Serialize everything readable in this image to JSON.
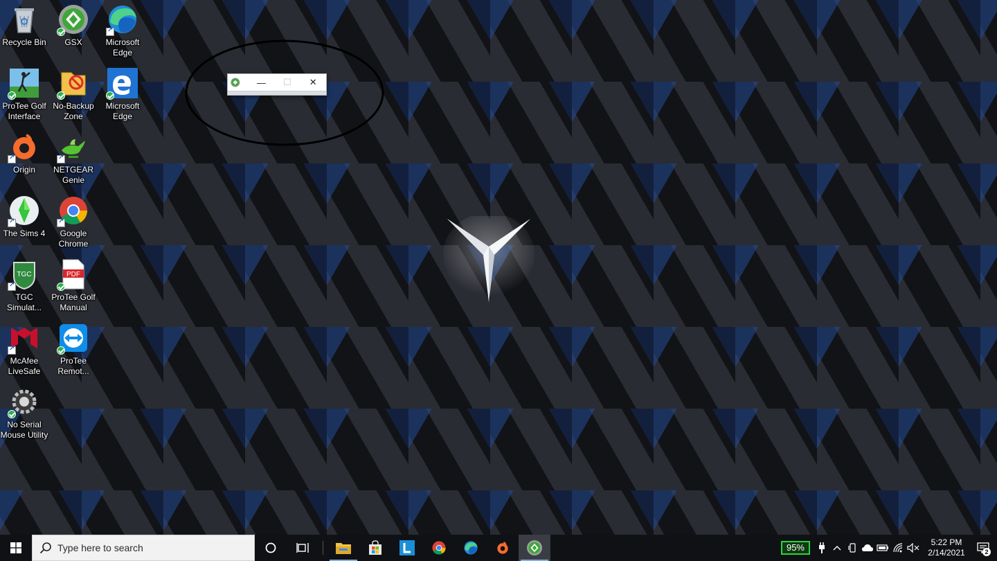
{
  "desktop": {
    "icons": [
      {
        "label": "Recycle Bin",
        "icon": "recycle-bin-icon"
      },
      {
        "label": "GSX",
        "icon": "gsx-icon"
      },
      {
        "label": "Microsoft Edge",
        "icon": "edge-new-icon"
      },
      {
        "label": "ProTee Golf Interface",
        "icon": "golfer-icon"
      },
      {
        "label": "No-Backup Zone",
        "icon": "no-backup-folder-icon"
      },
      {
        "label": "Microsoft Edge",
        "icon": "edge-legacy-icon"
      },
      {
        "label": "Origin",
        "icon": "origin-icon"
      },
      {
        "label": "NETGEAR Genie",
        "icon": "genie-lamp-icon"
      },
      {
        "label": "The Sims 4",
        "icon": "sims-plumbob-icon"
      },
      {
        "label": "Google Chrome",
        "icon": "chrome-icon"
      },
      {
        "label": "TGC Simulat...",
        "icon": "tgc-icon"
      },
      {
        "label": "ProTee Golf Manual",
        "icon": "pdf-icon"
      },
      {
        "label": "McAfee LiveSafe",
        "icon": "mcafee-icon"
      },
      {
        "label": "ProTee Remot...",
        "icon": "teamviewer-icon"
      },
      {
        "label": "No Serial Mouse Utility",
        "icon": "gear-icon"
      }
    ]
  },
  "mini_window": {
    "minimize_glyph": "—",
    "maximize_glyph": "☐",
    "close_glyph": "✕"
  },
  "taskbar": {
    "search_placeholder": "Type here to search",
    "apps": [
      "file-explorer-icon",
      "store-icon",
      "l-app-icon",
      "chrome-icon",
      "edge-icon",
      "origin-icon",
      "gsx-icon"
    ]
  },
  "tray": {
    "battery_percent": "95%",
    "time": "5:22 PM",
    "date": "2/14/2021",
    "notification_count": "2"
  },
  "colors": {
    "taskbar": "#101114",
    "battery_border": "#2ed243",
    "accent_blue": "#1f6fd1"
  }
}
